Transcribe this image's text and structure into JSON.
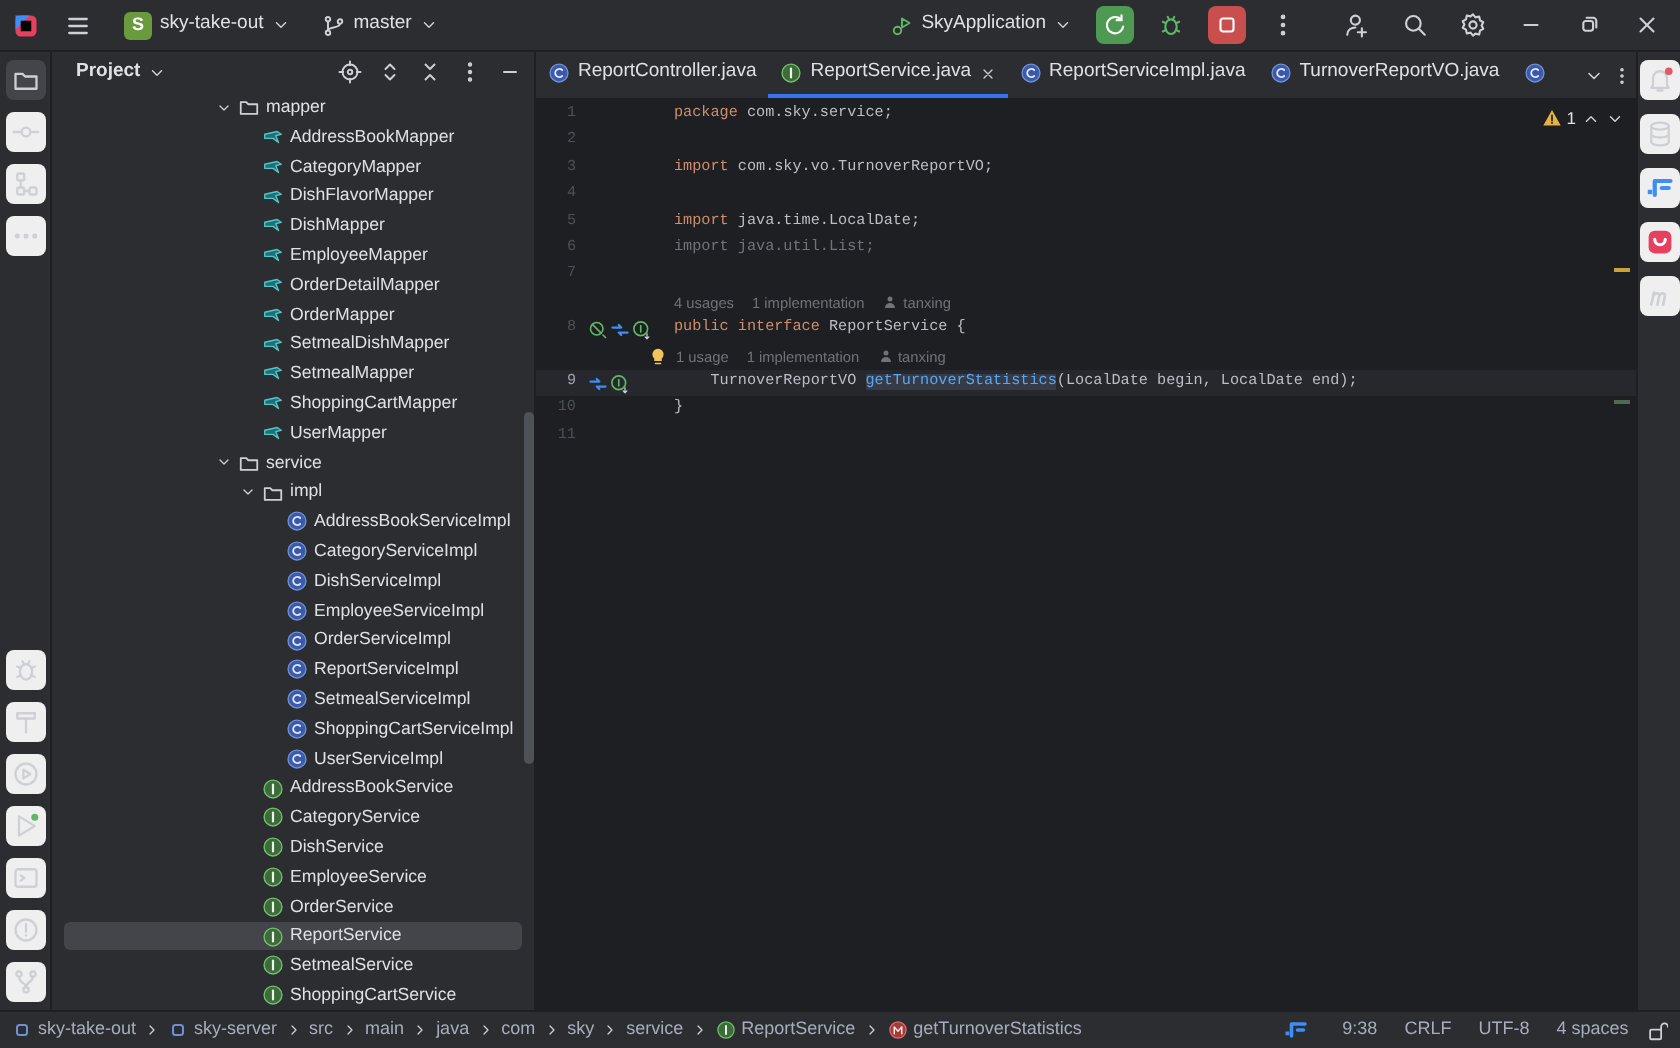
{
  "title_bar": {
    "project_initial": "S",
    "project": "sky-take-out",
    "branch": "master",
    "run_config": "SkyApplication"
  },
  "project_panel": {
    "title": "Project",
    "tree": [
      {
        "label": "mapper",
        "kind": "folder",
        "expanded": true,
        "selected": false,
        "children": [
          {
            "label": "AddressBookMapper",
            "kind": "mapper",
            "selected": false
          },
          {
            "label": "CategoryMapper",
            "kind": "mapper",
            "selected": false
          },
          {
            "label": "DishFlavorMapper",
            "kind": "mapper",
            "selected": false
          },
          {
            "label": "DishMapper",
            "kind": "mapper",
            "selected": false
          },
          {
            "label": "EmployeeMapper",
            "kind": "mapper",
            "selected": false
          },
          {
            "label": "OrderDetailMapper",
            "kind": "mapper",
            "selected": false
          },
          {
            "label": "OrderMapper",
            "kind": "mapper",
            "selected": false
          },
          {
            "label": "SetmealDishMapper",
            "kind": "mapper",
            "selected": false
          },
          {
            "label": "SetmealMapper",
            "kind": "mapper",
            "selected": false
          },
          {
            "label": "ShoppingCartMapper",
            "kind": "mapper",
            "selected": false
          },
          {
            "label": "UserMapper",
            "kind": "mapper",
            "selected": false
          }
        ]
      },
      {
        "label": "service",
        "kind": "folder",
        "expanded": true,
        "selected": false,
        "children": [
          {
            "label": "impl",
            "kind": "folder",
            "expanded": true,
            "selected": false,
            "children": [
              {
                "label": "AddressBookServiceImpl",
                "kind": "class",
                "selected": false
              },
              {
                "label": "CategoryServiceImpl",
                "kind": "class",
                "selected": false
              },
              {
                "label": "DishServiceImpl",
                "kind": "class",
                "selected": false
              },
              {
                "label": "EmployeeServiceImpl",
                "kind": "class",
                "selected": false
              },
              {
                "label": "OrderServiceImpl",
                "kind": "class",
                "selected": false
              },
              {
                "label": "ReportServiceImpl",
                "kind": "class",
                "selected": false
              },
              {
                "label": "SetmealServiceImpl",
                "kind": "class",
                "selected": false
              },
              {
                "label": "ShoppingCartServiceImpl",
                "kind": "class",
                "selected": false
              },
              {
                "label": "UserServiceImpl",
                "kind": "class",
                "selected": false
              }
            ]
          },
          {
            "label": "AddressBookService",
            "kind": "interface",
            "selected": false
          },
          {
            "label": "CategoryService",
            "kind": "interface",
            "selected": false
          },
          {
            "label": "DishService",
            "kind": "interface",
            "selected": false
          },
          {
            "label": "EmployeeService",
            "kind": "interface",
            "selected": false
          },
          {
            "label": "OrderService",
            "kind": "interface",
            "selected": false
          },
          {
            "label": "ReportService",
            "kind": "interface",
            "selected": true
          },
          {
            "label": "SetmealService",
            "kind": "interface",
            "selected": false
          },
          {
            "label": "ShoppingCartService",
            "kind": "interface",
            "selected": false
          }
        ]
      }
    ]
  },
  "tabs": [
    {
      "label": "ReportController.java",
      "kind": "class",
      "selected": false
    },
    {
      "label": "ReportService.java",
      "kind": "interface",
      "selected": true
    },
    {
      "label": "ReportServiceImpl.java",
      "kind": "class",
      "selected": false
    },
    {
      "label": "TurnoverReportVO.java",
      "kind": "class",
      "selected": false
    },
    {
      "kind": "class",
      "selected": false
    }
  ],
  "editor": {
    "warnings": "1",
    "rows": [
      {
        "kind": "code",
        "number": "1",
        "current": false,
        "tokens": [
          {
            "kind": "keyword",
            "text": "package"
          },
          {
            "kind": "plain",
            "text": " com.sky.service;"
          }
        ]
      },
      {
        "kind": "code",
        "number": "2",
        "current": false
      },
      {
        "kind": "code",
        "number": "3",
        "current": false,
        "tokens": [
          {
            "kind": "keyword",
            "text": "import"
          },
          {
            "kind": "plain",
            "text": " com.sky.vo.TurnoverReportVO;"
          }
        ]
      },
      {
        "kind": "code",
        "number": "4",
        "current": false
      },
      {
        "kind": "code",
        "number": "5",
        "current": false,
        "tokens": [
          {
            "kind": "keyword",
            "text": "import"
          },
          {
            "kind": "plain",
            "text": " java.time.LocalDate;"
          }
        ]
      },
      {
        "kind": "code",
        "number": "6",
        "current": false,
        "tokens": [
          {
            "kind": "unused",
            "text": "import java.util.List;"
          }
        ]
      },
      {
        "kind": "code",
        "number": "7",
        "current": false
      },
      {
        "kind": "hint",
        "bulb": false,
        "hints": [
          {
            "kind": "count",
            "text": "4 usages"
          },
          {
            "kind": "count",
            "text": "1 implementation"
          },
          {
            "kind": "author",
            "text": "tanxing"
          }
        ]
      },
      {
        "kind": "code",
        "number": "8",
        "current": false,
        "gutter": [
          {
            "kind": "override"
          },
          {
            "kind": "jump"
          },
          {
            "kind": "implemented"
          }
        ],
        "tokens": [
          {
            "kind": "keyword",
            "text": "public interface"
          },
          {
            "kind": "plain",
            "text": " ReportService {"
          }
        ]
      },
      {
        "kind": "hint",
        "bulb": true,
        "hints": [
          {
            "kind": "count",
            "text": "1 usage"
          },
          {
            "kind": "count",
            "text": "1 implementation"
          },
          {
            "kind": "author",
            "text": "tanxing"
          }
        ]
      },
      {
        "kind": "code",
        "number": "9",
        "current": true,
        "gutter": [
          {
            "kind": "jump"
          },
          {
            "kind": "implemented"
          }
        ],
        "tokens": [
          {
            "kind": "plain",
            "text": "    TurnoverReportVO "
          },
          {
            "kind": "method",
            "text": "getTurnoverStatistics"
          },
          {
            "kind": "plain",
            "text": "(LocalDate begin, LocalDate end);"
          }
        ]
      },
      {
        "kind": "code",
        "number": "10",
        "current": false,
        "tokens": [
          {
            "kind": "plain",
            "text": "}"
          }
        ]
      },
      {
        "kind": "code",
        "number": "11",
        "current": false
      }
    ]
  },
  "status_bar": {
    "breadcrumbs": [
      {
        "kind": "module",
        "text": "sky-take-out"
      },
      {
        "kind": "module",
        "text": "sky-server"
      },
      {
        "kind": "folder",
        "text": "src"
      },
      {
        "kind": "folder",
        "text": "main"
      },
      {
        "kind": "folder",
        "text": "java"
      },
      {
        "kind": "folder",
        "text": "com"
      },
      {
        "kind": "folder",
        "text": "sky"
      },
      {
        "kind": "folder",
        "text": "service"
      },
      {
        "kind": "interface",
        "text": "ReportService"
      },
      {
        "kind": "method",
        "text": "getTurnoverStatistics"
      }
    ],
    "position": "9:38",
    "line_separator": "CRLF",
    "encoding": "UTF-8",
    "indent": "4 spaces"
  }
}
